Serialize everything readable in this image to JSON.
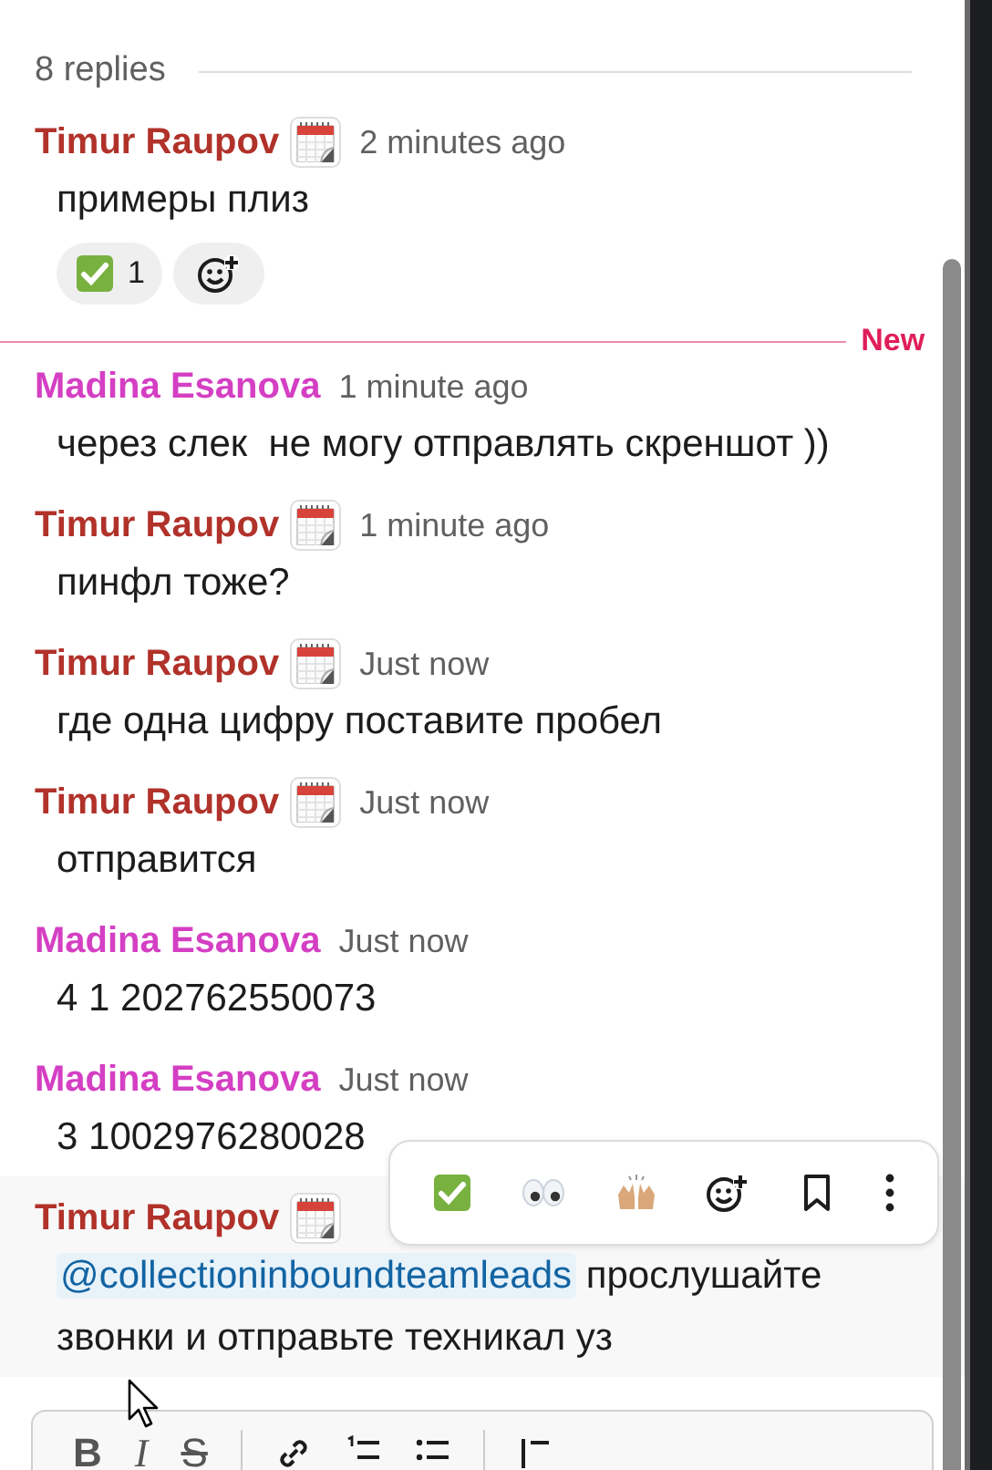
{
  "replies_label": "8 replies",
  "items": [
    {
      "kind": "message",
      "author": "Timur Raupov",
      "color": "#b1322a",
      "status_icon": true,
      "time": "2 minutes ago",
      "text": "примеры плиз",
      "hovered": false,
      "reactions": [
        {
          "count": "1"
        }
      ]
    },
    {
      "kind": "divider",
      "label": "New"
    },
    {
      "kind": "message",
      "author": "Madina Esanova",
      "color": "#d43fc3",
      "status_icon": false,
      "time": "1 minute ago",
      "text": "через слек  не могу отправлять скреншот ))",
      "hovered": false
    },
    {
      "kind": "message",
      "author": "Timur Raupov",
      "color": "#b1322a",
      "status_icon": true,
      "time": "1 minute ago",
      "text": "пинфл тоже?",
      "hovered": false
    },
    {
      "kind": "message",
      "author": "Timur Raupov",
      "color": "#b1322a",
      "status_icon": true,
      "time": "Just now",
      "text": "где одна цифру поставите пробел",
      "hovered": false
    },
    {
      "kind": "message",
      "author": "Timur Raupov",
      "color": "#b1322a",
      "status_icon": true,
      "time": "Just now",
      "text": "отправится",
      "hovered": false
    },
    {
      "kind": "message",
      "author": "Madina Esanova",
      "color": "#d43fc3",
      "status_icon": false,
      "time": "Just now",
      "text": "4 1 202762550073",
      "hovered": false
    },
    {
      "kind": "message",
      "author": "Madina Esanova",
      "color": "#d43fc3",
      "status_icon": false,
      "time": "Just now",
      "text": "3 1002976280028",
      "hovered": false
    },
    {
      "kind": "message",
      "author": "Timur Raupov",
      "color": "#b1322a",
      "status_icon": true,
      "mention": "@collectioninboundteamleads",
      "text": " прослушайте звонки и отправьте техникал уз",
      "hovered": true
    }
  ],
  "composer": {
    "format_buttons": [
      "B",
      "I",
      "S"
    ]
  }
}
